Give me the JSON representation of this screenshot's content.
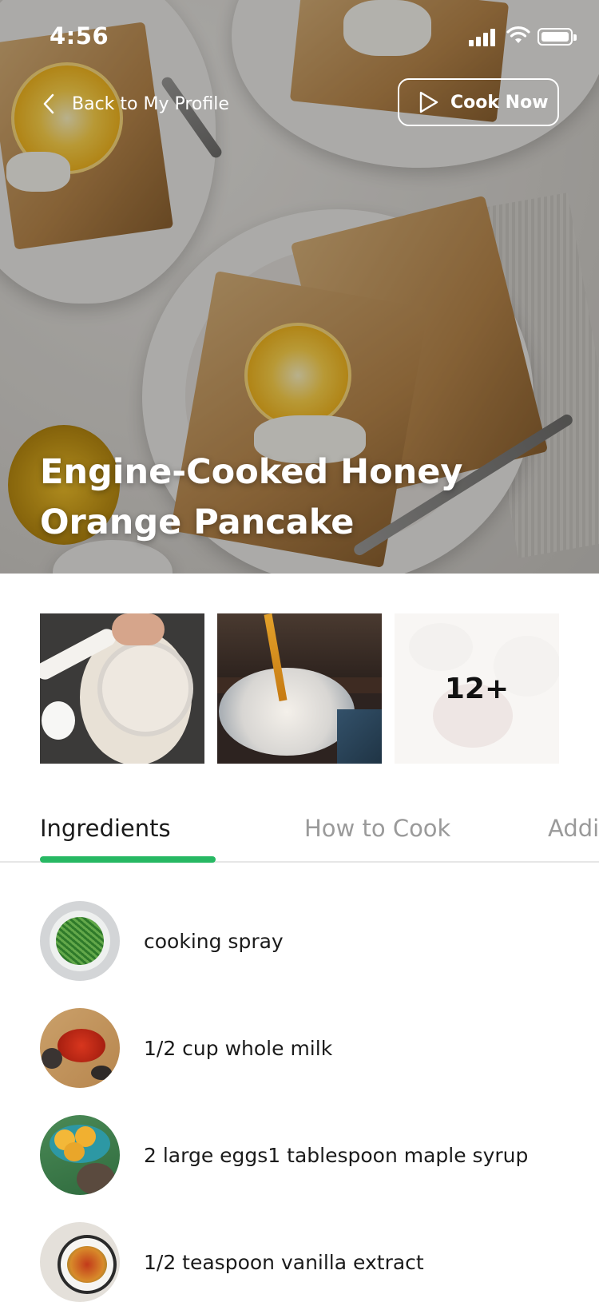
{
  "status_bar": {
    "time": "4:56"
  },
  "header": {
    "back_label": "Back to My Profile",
    "cook_label": "Cook Now"
  },
  "recipe": {
    "title_line1": "Engine-Cooked Honey",
    "title_line2": "Orange Pancake"
  },
  "gallery": {
    "more_count": "12+"
  },
  "tabs": [
    {
      "label": "Ingredients",
      "active": true
    },
    {
      "label": "How to Cook",
      "active": false
    },
    {
      "label": "Addi",
      "active": false
    }
  ],
  "ingredients": [
    {
      "text": "cooking spray",
      "icon": "greens-bowl"
    },
    {
      "text": "1/2 cup whole milk",
      "icon": "red-spice"
    },
    {
      "text": "2 large eggs1 tablespoon maple syrup",
      "icon": "eggs-bowl"
    },
    {
      "text": "1/2 teaspoon vanilla extract",
      "icon": "spice-bowl"
    }
  ],
  "colors": {
    "accent": "#27b863"
  }
}
